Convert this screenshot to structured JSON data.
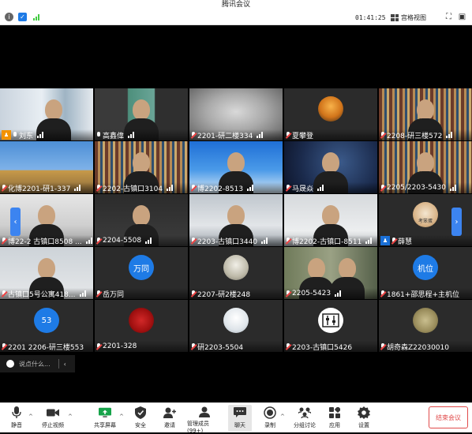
{
  "window": {
    "title": "腾讯会议"
  },
  "topbar": {
    "timer": "01:41:25",
    "view_mode": "宫格视图"
  },
  "grid": {
    "tiles": [
      {
        "name": "刘东",
        "mic": "on",
        "host": true,
        "video": true,
        "scene": "room"
      },
      {
        "name": "高鑫偉",
        "mic": "on",
        "video": true,
        "scene": "face"
      },
      {
        "name": "2201-研二楼334",
        "mic": "off",
        "video": true,
        "scene": "blur"
      },
      {
        "name": "夏攀登",
        "mic": "off",
        "video": false,
        "avatar": "sunset"
      },
      {
        "name": "2208-研三楼572",
        "mic": "off",
        "video": true,
        "scene": "shelf"
      },
      {
        "name": "化博2201-研1-337",
        "mic": "off",
        "video": true,
        "scene": "statue"
      },
      {
        "name": "2202-古镇口3104",
        "mic": "off",
        "video": true,
        "scene": "shelf"
      },
      {
        "name": "博2202-8513",
        "mic": "off",
        "video": true,
        "scene": "sky"
      },
      {
        "name": "马晟焱",
        "mic": "off",
        "video": true,
        "scene": "stars"
      },
      {
        "name": "2205/2203-5430",
        "mic": "off",
        "video": true,
        "scene": "shelf"
      },
      {
        "name": "博22-2 古镇口8508 ...",
        "mic": "off",
        "video": true,
        "scene": "ceiling"
      },
      {
        "name": "2204-5508",
        "mic": "off",
        "video": true,
        "scene": "dim"
      },
      {
        "name": "2203-古镇口3440",
        "mic": "off",
        "video": true,
        "scene": "face2"
      },
      {
        "name": "博2202-古镇口-8511",
        "mic": "off",
        "video": true,
        "scene": "face3"
      },
      {
        "name": "薛慧",
        "mic": "off",
        "cohost": true,
        "video": false,
        "avatar": "cat",
        "avatar_text": "考笨蛋"
      },
      {
        "name": "古镇口5号公寓418...",
        "mic": "off",
        "video": true,
        "scene": "face4"
      },
      {
        "name": "岳万同",
        "mic": "off",
        "video": false,
        "avatar": "blue",
        "avatar_text": "万同"
      },
      {
        "name": "2207-研2楼248",
        "mic": "off",
        "video": false,
        "avatar": "lamp"
      },
      {
        "name": "2205-5423",
        "mic": "off",
        "video": true,
        "scene": "two"
      },
      {
        "name": "1861+邵思程+主机位",
        "mic": "off",
        "video": false,
        "avatar": "blue",
        "avatar_text": "机位"
      },
      {
        "name": "2201 2206-研三楼553",
        "mic": "off",
        "video": false,
        "avatar": "blue",
        "avatar_text": "53"
      },
      {
        "name": "2201-328",
        "mic": "off",
        "video": false,
        "avatar": "red"
      },
      {
        "name": "研2203-5504",
        "mic": "off",
        "video": false,
        "avatar": "girl"
      },
      {
        "name": "2203-古镇口5426",
        "mic": "off",
        "video": false,
        "avatar": "sliders"
      },
      {
        "name": "胡奇森Z22030010",
        "mic": "off",
        "video": false,
        "avatar": "art"
      }
    ]
  },
  "chat": {
    "placeholder": "说点什么..."
  },
  "toolbar": {
    "mute": "静音",
    "video": "停止视频",
    "share": "共享屏幕",
    "security": "安全",
    "invite": "邀请",
    "members": "管理成员(99+)",
    "chat": "聊天",
    "record": "录制",
    "breakout": "分组讨论",
    "apps": "应用",
    "settings": "设置",
    "end": "结束会议"
  },
  "colors": {
    "accent": "#1e7be6",
    "danger": "#e14b4b",
    "host": "#f39200"
  }
}
